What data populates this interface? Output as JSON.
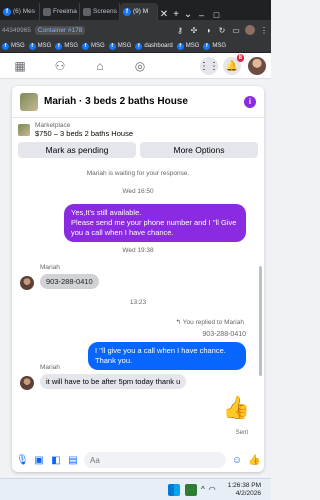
{
  "browser": {
    "tabs": [
      {
        "label": "(6) Mes",
        "icon": "facebook-icon"
      },
      {
        "label": "Freeima",
        "icon": "page-icon"
      },
      {
        "label": "Screens",
        "icon": "page-icon"
      },
      {
        "label": "(9) M",
        "icon": "facebook-icon",
        "active": true
      }
    ],
    "new_tab": "+",
    "address_prefix": "44349965",
    "container": "Container #178",
    "bookmarks": [
      "MSG",
      "MSG",
      "MSG",
      "MSG",
      "MSG",
      "dashboard",
      "MSG",
      "MSG"
    ]
  },
  "fb_nav": {
    "notification_count": "8"
  },
  "chat": {
    "title": "Mariah · 3 beds 2 baths House",
    "marketplace_label": "Marketplace",
    "listing": "$750 – 3 beds 2 baths House",
    "mark_pending": "Mark as pending",
    "more_options": "More Options",
    "waiting_note": "Mariah is waiting for your response.",
    "time1": "Wed 16:50",
    "msg1": "Yes,It's still available.\nPlease send me your phone number and I ''ll Give you a call when I have chance.",
    "time2": "Wed 19:38",
    "sender1": "Mariah",
    "phone_msg": "903-288-0410",
    "time3": "13:23",
    "replied_note": "You replied to Mariah",
    "quoted": "903-288-0410",
    "msg2": "I ''ll give you a call when I have chance. Thank you.",
    "sender2": "Mariah",
    "msg3": "it will have to be after 5pm today thank u",
    "sent_status": "Sent",
    "composer_placeholder": "Aa"
  },
  "taskbar": {
    "time": "1:26:38 PM",
    "date": "4/2/2026"
  },
  "colors": {
    "facebook_blue": "#1877f2",
    "purple_bubble": "#8a2be2",
    "blue_bubble": "#0866ff"
  }
}
